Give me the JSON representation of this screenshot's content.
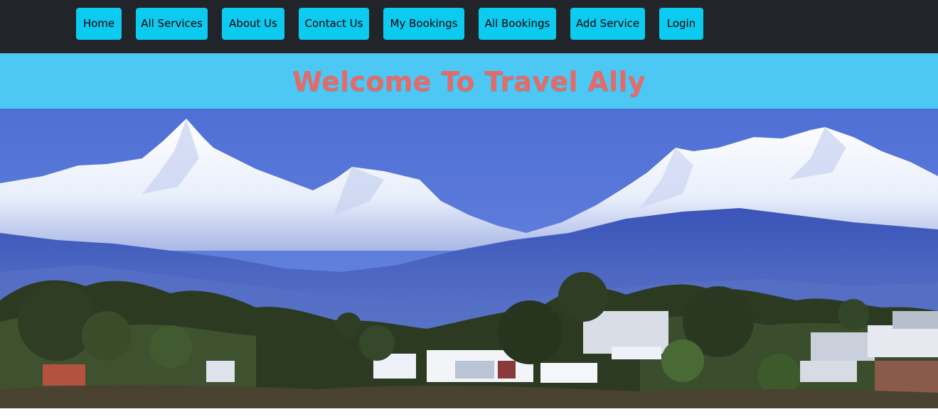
{
  "navbar": {
    "background": "#212529",
    "button_color": "#0dcaf0",
    "items": [
      {
        "label": "Home"
      },
      {
        "label": "All Services"
      },
      {
        "label": "About Us"
      },
      {
        "label": "Contact Us"
      },
      {
        "label": "My Bookings"
      },
      {
        "label": "All Bookings"
      },
      {
        "label": "Add Service"
      },
      {
        "label": "Login"
      }
    ]
  },
  "hero": {
    "title": "Welcome To Travel Ally",
    "band_color": "#4dc8f5",
    "title_color": "#e66a68"
  },
  "banner": {
    "image": "mountain-lake-town-photo"
  }
}
